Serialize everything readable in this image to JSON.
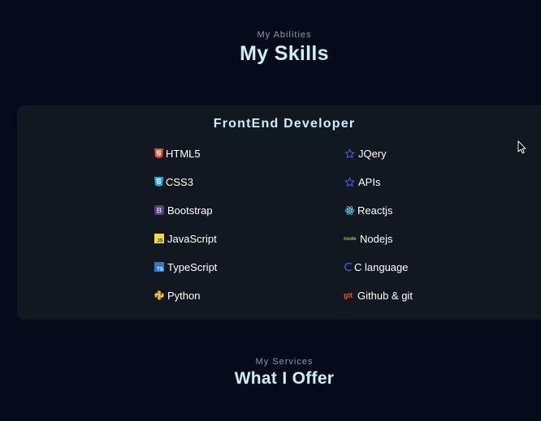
{
  "abilities": {
    "eyebrow": "My Abilities",
    "title": "My Skills"
  },
  "frontend_card": {
    "title": "FrontEnd Developer",
    "left_column": [
      {
        "label": "HTML5",
        "icon": "html5-icon"
      },
      {
        "label": "CSS3",
        "icon": "css3-icon"
      },
      {
        "label": "Bootstrap",
        "icon": "bootstrap-icon"
      },
      {
        "label": "JavaScript",
        "icon": "javascript-icon"
      },
      {
        "label": "TypeScript",
        "icon": "typescript-icon"
      },
      {
        "label": "Python",
        "icon": "python-icon"
      }
    ],
    "right_column": [
      {
        "label": "JQery",
        "icon": "star-icon"
      },
      {
        "label": "APIs",
        "icon": "star-icon"
      },
      {
        "label": "Reactjs",
        "icon": "react-icon"
      },
      {
        "label": "Nodejs",
        "icon": "nodejs-icon"
      },
      {
        "label": "C language",
        "icon": "c-language-icon"
      },
      {
        "label": "Github & git",
        "icon": "git-icon"
      }
    ]
  },
  "services": {
    "eyebrow": "My Services",
    "title": "What I Offer"
  },
  "colors": {
    "background": "#050a1c",
    "card": "#121820",
    "heading": "#c8f2fb",
    "eyebrow": "#8f98b0",
    "html5": "#e44d26",
    "css3": "#2aa3d9",
    "bootstrap": "#563d7c",
    "javascript": "#f0db4f",
    "typescript": "#3178c6",
    "python": "#f7c530",
    "star": "#3b55e6",
    "react": "#61dafb",
    "nodejs": "#83cd29",
    "c_language": "#3b55e6",
    "git": "#f05033"
  }
}
